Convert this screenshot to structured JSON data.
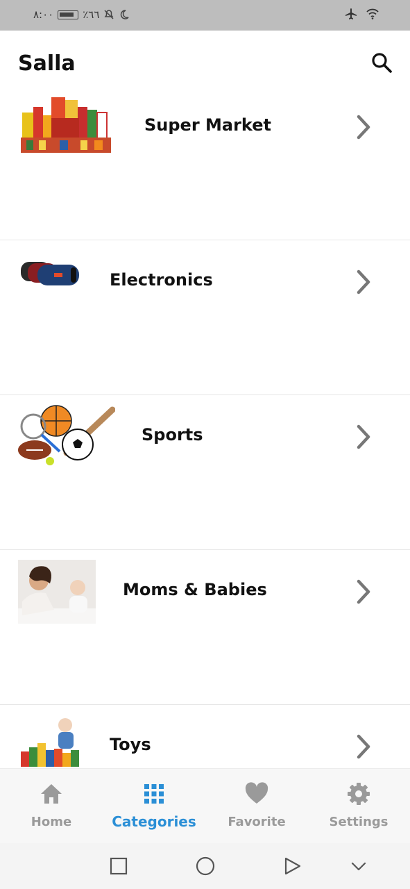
{
  "status_bar": {
    "time": "٨:٠٠",
    "battery": "٪٦٦"
  },
  "app_bar": {
    "title": "Salla"
  },
  "categories": [
    {
      "label": "Super Market",
      "thumb_icon": "grocery-products-image"
    },
    {
      "label": "Electronics",
      "thumb_icon": "speaker-image"
    },
    {
      "label": "Sports",
      "thumb_icon": "sports-balls-image"
    },
    {
      "label": "Moms & Babies",
      "thumb_icon": "mother-baby-image"
    },
    {
      "label": "Toys",
      "thumb_icon": "toy-blocks-image"
    }
  ],
  "bottom_nav": {
    "items": [
      {
        "label": "Home",
        "icon": "home-icon",
        "active": false
      },
      {
        "label": "Categories",
        "icon": "grid-icon",
        "active": true
      },
      {
        "label": "Favorite",
        "icon": "heart-icon",
        "active": false
      },
      {
        "label": "Settings",
        "icon": "gear-icon",
        "active": false
      }
    ]
  },
  "colors": {
    "accent": "#2b8fd6",
    "inactive": "#9a9a9a",
    "status_bar": "#bdbdbd"
  }
}
